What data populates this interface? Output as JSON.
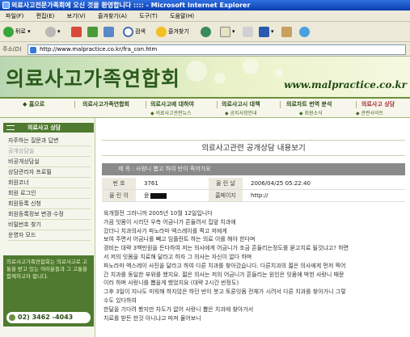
{
  "window": {
    "title": "의료사고전문가족회에 오신 것을 환영합니다 :::: - Microsoft Internet Explorer"
  },
  "menu": [
    "파일(F)",
    "편집(E)",
    "보기(V)",
    "즐겨찾기(A)",
    "도구(T)",
    "도움말(H)"
  ],
  "toolbar": {
    "back": "뒤로",
    "search": "검색",
    "favorites": "즐겨찾기"
  },
  "address": {
    "label": "주소(D)",
    "url": "http://www.malpractice.co.kr/fra_con.htm"
  },
  "site": {
    "logo": "의료사고가족연합회",
    "url_text": "www.malpractice.co.kr"
  },
  "nav": {
    "items": [
      "홈으로",
      "의료사고가족연합회",
      "의료사고에 대하여",
      "의료사고시 대책",
      "의료차트 번역 분석",
      "의료사고 상담"
    ],
    "sub": [
      "의료사고관련뉴스",
      "공지사항안내",
      "회원소식",
      "관련사이트"
    ]
  },
  "sidebar": {
    "heading": "의료사고 상담",
    "items": [
      "자주하는 질문과 답변",
      "공개상담실",
      "비공개상담실",
      "상담관리자 프로필",
      "회원코너",
      "회원 로그인",
      "회원등록 신청",
      "회원등록정보 변경·수정",
      "비밀번호 찾기",
      "운영자 모드"
    ],
    "current_index": 1,
    "info": "의료사고가족연합회는 의료사고로 고통을 받고 있는 여러분들과 그 고통을 함께하고자 합니다.",
    "phone": "02) 3462 -4043"
  },
  "post": {
    "page_title": "의료사고관련 공개상담 내용보기",
    "subject_label": "제 목 : 사랑니 뽑고 하여 반이 죽어가요",
    "number_label": "번 호",
    "number": "3761",
    "date_label": "올 린 날",
    "date": "2006/04/25  05:22:40",
    "author_label": "올 린 이",
    "author": "윤",
    "homepage_label": "홈페이지",
    "homepage": "http://",
    "body": [
      "육개월전 그러니까 2005년 10월 12일입니다",
      "가끔 잇몸이 시리던 우측 어금니가 흔들려서 집앞 치과에",
      "갔더니 치과의사가 파노라마 엑스레이를 찍고 저에게",
      "보여 주면서 어금니를 빼고 임플란트 하는 의료 이를 해야 한다며",
      "경비는 대략 3백만원을 든다하여 저는 의사에게 어금니가 조금 흔들리는정도를 묻고치료 될것냐고? 하면",
      "서 저의 잇몸을 치료해 달라고 하자 그 의사는 자신이 없다 하며",
      "파노라마 엑스레이 사진을 달라고 하여 다른 치과를 찾아갔습니다. 다른치과의 젊은 의사에게 먼저 찍어",
      "간 치과를 동일한 부위를 했지요. 젊은 의사는 저의 어금니가 흔들리는 원인은 잇몸에 박힌 사랑니 때문",
      "이라 하며 사랑니를 뽑을게 했었지요 (대략 2시간 반정도)",
      "그후 3일이 지나도 미워해 하지않은 하던 반이 붓고 토론잇몸 전체가 시려서 다른 치과를 찾아가니 그렇",
      "수도 있다하여",
      "한달을 기다려 봤지만 차도가 없어 사랑니 뽑은 치과에 찾아가서",
      "치료를 받든 한것 아니냐고 따져 물어보니"
    ]
  }
}
